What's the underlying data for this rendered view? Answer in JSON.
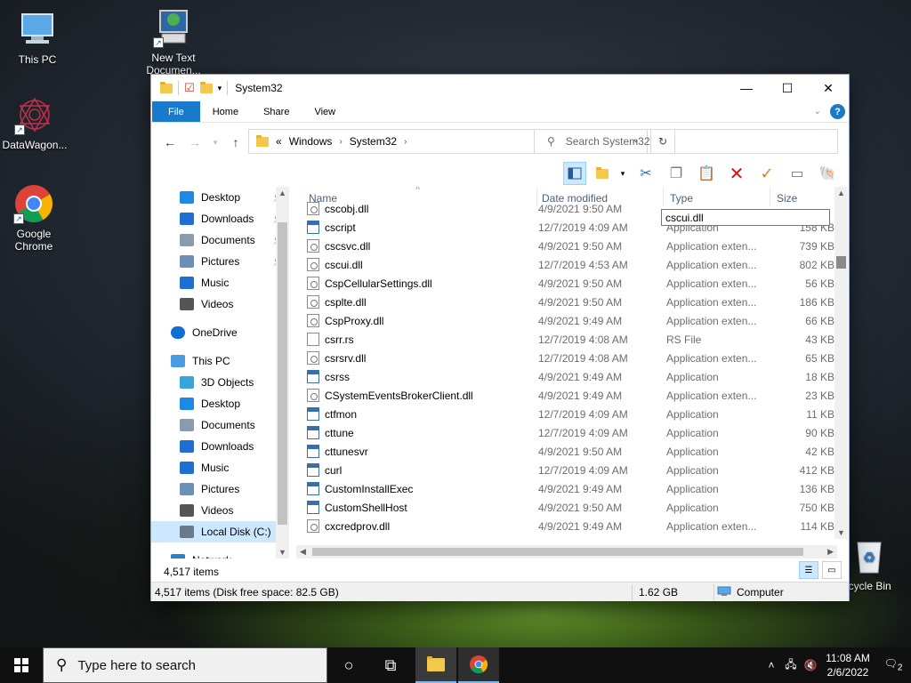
{
  "desktop": {
    "icons": [
      {
        "label": "This PC"
      },
      {
        "label": "New Text Documen..."
      },
      {
        "label": "DataWagon..."
      },
      {
        "label": "Google Chrome"
      },
      {
        "label": "Recycle Bin"
      }
    ]
  },
  "window": {
    "title": "System32",
    "ribbon_tabs": [
      "File",
      "Home",
      "Share",
      "View"
    ],
    "help_label": "?",
    "address": {
      "overflow": "«",
      "crumbs": [
        "Windows",
        "System32"
      ]
    },
    "search_placeholder": "Search System32",
    "columns": {
      "name": "Name",
      "date": "Date modified",
      "type": "Type",
      "size": "Size"
    },
    "tooltip": "cscui.dll",
    "nav": [
      {
        "label": "Desktop",
        "icon": "desktop-icon",
        "pinned": true
      },
      {
        "label": "Downloads",
        "icon": "downloads-icon",
        "pinned": true
      },
      {
        "label": "Documents",
        "icon": "documents-icon",
        "pinned": true
      },
      {
        "label": "Pictures",
        "icon": "pictures-icon",
        "pinned": true
      },
      {
        "label": "Music",
        "icon": "music-icon",
        "pinned": false
      },
      {
        "label": "Videos",
        "icon": "videos-icon",
        "pinned": false
      },
      {
        "label": "OneDrive",
        "icon": "onedrive-icon",
        "pinned": false
      },
      {
        "label": "This PC",
        "icon": "this-pc-icon",
        "pinned": false
      },
      {
        "label": "3D Objects",
        "icon": "3d-objects-icon",
        "pinned": false
      },
      {
        "label": "Desktop",
        "icon": "desktop-icon",
        "pinned": false
      },
      {
        "label": "Documents",
        "icon": "documents-icon",
        "pinned": false
      },
      {
        "label": "Downloads",
        "icon": "downloads-icon",
        "pinned": false
      },
      {
        "label": "Music",
        "icon": "music-icon",
        "pinned": false
      },
      {
        "label": "Pictures",
        "icon": "pictures-icon",
        "pinned": false
      },
      {
        "label": "Videos",
        "icon": "videos-icon",
        "pinned": false
      },
      {
        "label": "Local Disk (C:)",
        "icon": "local-disk-icon",
        "pinned": false
      },
      {
        "label": "Network",
        "icon": "network-icon",
        "pinned": false
      }
    ],
    "files": [
      {
        "name": "cscobj.dll",
        "date": "4/9/2021 9:50 AM",
        "type": "",
        "size": "",
        "icon": "dll"
      },
      {
        "name": "cscript",
        "date": "12/7/2019 4:09 AM",
        "type": "Application",
        "size": "158 KB",
        "icon": "app"
      },
      {
        "name": "cscsvc.dll",
        "date": "4/9/2021 9:50 AM",
        "type": "Application exten...",
        "size": "739 KB",
        "icon": "dll"
      },
      {
        "name": "cscui.dll",
        "date": "12/7/2019 4:53 AM",
        "type": "Application exten...",
        "size": "802 KB",
        "icon": "dll"
      },
      {
        "name": "CspCellularSettings.dll",
        "date": "4/9/2021 9:50 AM",
        "type": "Application exten...",
        "size": "56 KB",
        "icon": "dll"
      },
      {
        "name": "csplte.dll",
        "date": "4/9/2021 9:50 AM",
        "type": "Application exten...",
        "size": "186 KB",
        "icon": "dll"
      },
      {
        "name": "CspProxy.dll",
        "date": "4/9/2021 9:49 AM",
        "type": "Application exten...",
        "size": "66 KB",
        "icon": "dll"
      },
      {
        "name": "csrr.rs",
        "date": "12/7/2019 4:08 AM",
        "type": "RS File",
        "size": "43 KB",
        "icon": "file"
      },
      {
        "name": "csrsrv.dll",
        "date": "12/7/2019 4:08 AM",
        "type": "Application exten...",
        "size": "65 KB",
        "icon": "dll"
      },
      {
        "name": "csrss",
        "date": "4/9/2021 9:49 AM",
        "type": "Application",
        "size": "18 KB",
        "icon": "app"
      },
      {
        "name": "CSystemEventsBrokerClient.dll",
        "date": "4/9/2021 9:49 AM",
        "type": "Application exten...",
        "size": "23 KB",
        "icon": "dll"
      },
      {
        "name": "ctfmon",
        "date": "12/7/2019 4:09 AM",
        "type": "Application",
        "size": "11 KB",
        "icon": "app"
      },
      {
        "name": "cttune",
        "date": "12/7/2019 4:09 AM",
        "type": "Application",
        "size": "90 KB",
        "icon": "app"
      },
      {
        "name": "cttunesvr",
        "date": "4/9/2021 9:50 AM",
        "type": "Application",
        "size": "42 KB",
        "icon": "app"
      },
      {
        "name": "curl",
        "date": "12/7/2019 4:09 AM",
        "type": "Application",
        "size": "412 KB",
        "icon": "app"
      },
      {
        "name": "CustomInstallExec",
        "date": "4/9/2021 9:49 AM",
        "type": "Application",
        "size": "136 KB",
        "icon": "app"
      },
      {
        "name": "CustomShellHost",
        "date": "4/9/2021 9:50 AM",
        "type": "Application",
        "size": "750 KB",
        "icon": "app"
      },
      {
        "name": "cxcredprov.dll",
        "date": "4/9/2021 9:49 AM",
        "type": "Application exten...",
        "size": "114 KB",
        "icon": "dll"
      }
    ],
    "item_count": "4,517 items",
    "status": {
      "items": "4,517 items (Disk free space: 82.5 GB)",
      "size": "1.62 GB",
      "location": "Computer"
    }
  },
  "taskbar": {
    "search_placeholder": "Type here to search",
    "time": "11:08 AM",
    "date": "2/6/2022",
    "notifications": "2"
  },
  "colors": {
    "accent": "#1979ca",
    "selection": "#cce8ff"
  }
}
